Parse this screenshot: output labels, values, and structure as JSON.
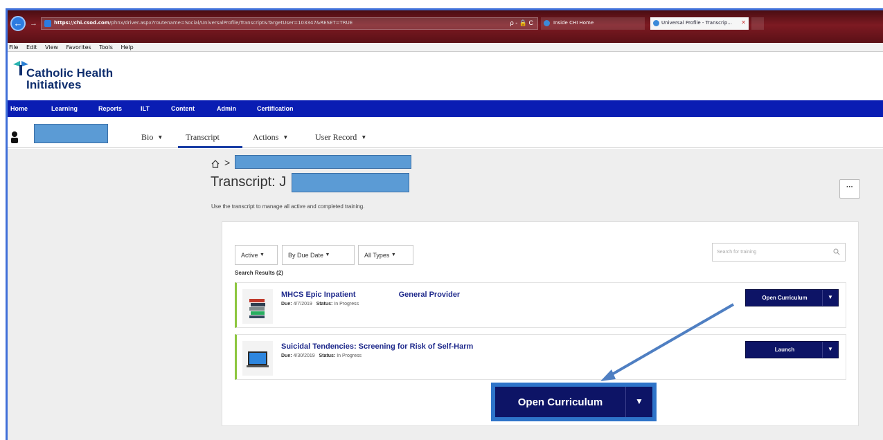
{
  "browser": {
    "url_host": "https://chi.csod.com",
    "url_path": "/phnx/driver.aspx?routename=Social/UniversalProfile/Transcript&TargetUser=103347&RESET=TRUE",
    "address_actions": "ρ - 🔒 C",
    "tab_inactive": "Inside CHI Home",
    "tab_active": "Universal Profile - Transcrip...",
    "tab_close": "✕",
    "menu": [
      "File",
      "Edit",
      "View",
      "Favorites",
      "Tools",
      "Help"
    ]
  },
  "header": {
    "logo_line1": "Catholic Health",
    "logo_line2": "Initiatives",
    "nav": [
      "Home",
      "Learning",
      "Reports",
      "ILT",
      "Content",
      "Admin",
      "Certification"
    ]
  },
  "profile": {
    "tabs": [
      {
        "label": "Bio",
        "caret": "▼"
      },
      {
        "label": "Transcript",
        "caret": ""
      },
      {
        "label": "Actions",
        "caret": "▼"
      },
      {
        "label": "User Record",
        "caret": "▼"
      }
    ]
  },
  "page": {
    "breadcrumb_sep": ">",
    "title": "Transcript: J",
    "description": "Use the transcript to manage all active and completed training.",
    "more_button": "···"
  },
  "filters": {
    "status": "Active",
    "sort": "By Due Date",
    "type": "All Types",
    "caret": "▼",
    "search_placeholder": "Search for training",
    "results_label": "Search Results (2)"
  },
  "items": [
    {
      "title": "MHCS Epic Inpatient",
      "subtitle": "General Provider",
      "due_label": "Due:",
      "due": "4/7/2019",
      "status_label": "Status:",
      "status": "In Progress",
      "button": "Open Curriculum",
      "caret": "▼",
      "thumb_icon": "books-icon"
    },
    {
      "title": "Suicidal Tendencies: Screening for Risk of Self-Harm",
      "subtitle": "",
      "due_label": "Due:",
      "due": "4/30/2019",
      "status_label": "Status:",
      "status": "In Progress",
      "button": "Launch",
      "caret": "▼",
      "thumb_icon": "monitor-icon"
    }
  ],
  "callout": {
    "label": "Open Curriculum",
    "caret": "▼"
  },
  "colors": {
    "nav_blue": "#0a1db3",
    "button_navy": "#0d1466",
    "redaction_blue": "#5b9bd5",
    "callout_border": "#2e74c9",
    "item_accent": "#8cc63f"
  }
}
